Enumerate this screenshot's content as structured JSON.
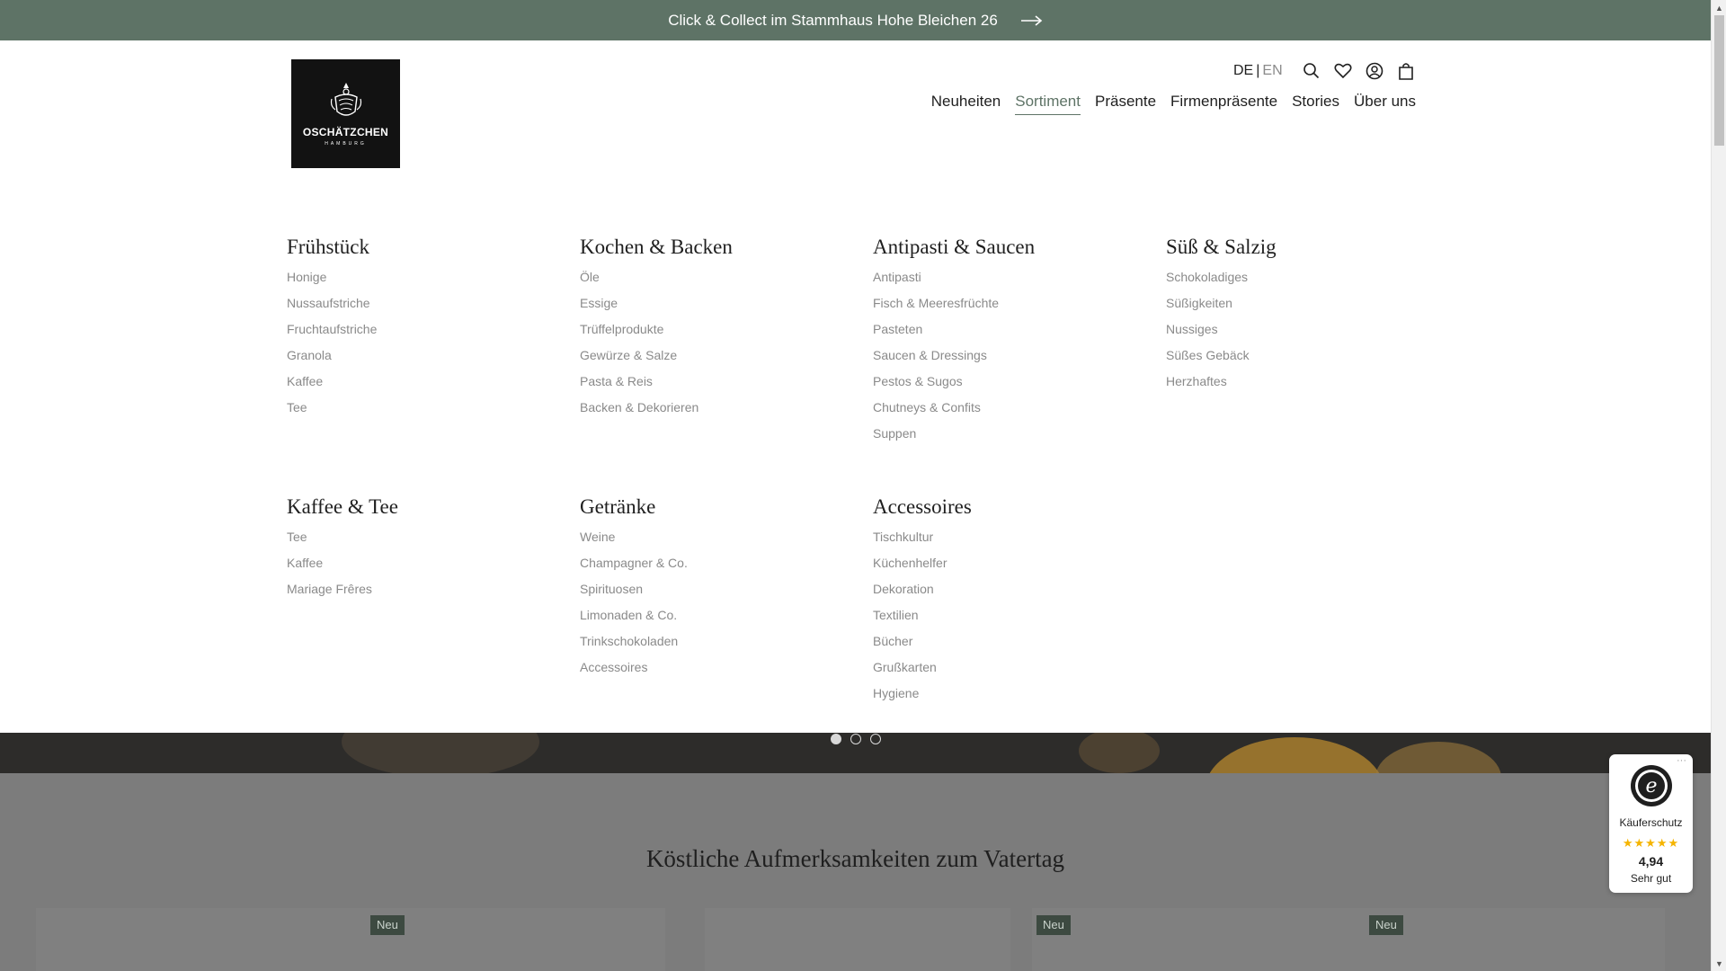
{
  "announcement": {
    "text": "Click & Collect im Stammhaus Hohe Bleichen 26"
  },
  "logo": {
    "brand": "OSCHÄTZCHEN",
    "city": "HAMBURG"
  },
  "language": {
    "active": "DE",
    "separator": "|",
    "inactive": "EN"
  },
  "tools": {
    "icons": [
      "search-icon",
      "heart-icon",
      "account-icon",
      "bag-icon"
    ]
  },
  "nav": {
    "items": [
      "Neuheiten",
      "Sortiment",
      "Präsente",
      "Firmenpräsente",
      "Stories",
      "Über uns"
    ],
    "active": "Sortiment"
  },
  "mega_menu": {
    "row1": [
      {
        "title": "Frühstück",
        "links": [
          "Honige",
          "Nussaufstriche",
          "Fruchtaufstriche",
          "Granola",
          "Kaffee",
          "Tee"
        ]
      },
      {
        "title": "Kochen & Backen",
        "links": [
          "Öle",
          "Essige",
          "Trüffelprodukte",
          "Gewürze & Salze",
          "Pasta & Reis",
          "Backen & Dekorieren"
        ]
      },
      {
        "title": "Antipasti & Saucen",
        "links": [
          "Antipasti",
          "Fisch & Meeresfrüchte",
          "Pasteten",
          "Saucen & Dressings",
          "Pestos & Sugos",
          "Chutneys & Confits",
          "Suppen"
        ]
      },
      {
        "title": "Süß & Salzig",
        "links": [
          "Schokoladiges",
          "Süßigkeiten",
          "Nussiges",
          "Süßes Gebäck",
          "Herzhaftes"
        ]
      }
    ],
    "row2": [
      {
        "title": "Kaffee & Tee",
        "links": [
          "Tee",
          "Kaffee",
          "Mariage Frêres"
        ]
      },
      {
        "title": "Getränke",
        "links": [
          "Weine",
          "Champagner & Co.",
          "Spirituosen",
          "Limonaden & Co.",
          "Trinkschokoladen",
          "Accessoires"
        ]
      },
      {
        "title": "Accessoires",
        "links": [
          "Tischkultur",
          "Küchenhelfer",
          "Dekoration",
          "Textilien",
          "Bücher",
          "Grußkarten",
          "Hygiene"
        ]
      }
    ]
  },
  "carousel": {
    "slide_count": 3,
    "active_index": 0
  },
  "section": {
    "title": "Köstliche Aufmerksamkeiten zum Vatertag",
    "badges": [
      "Neu",
      "Neu",
      "Neu"
    ]
  },
  "trust_badge": {
    "label": "Käuferschutz",
    "rating": "4,94",
    "verdict": "Sehr gut",
    "stars": "★★★★★",
    "more": "···"
  },
  "colors": {
    "accent": "#5e7366",
    "banner": "#5e7366",
    "badge_bg": "#3d4a41",
    "star": "#f5b400"
  }
}
